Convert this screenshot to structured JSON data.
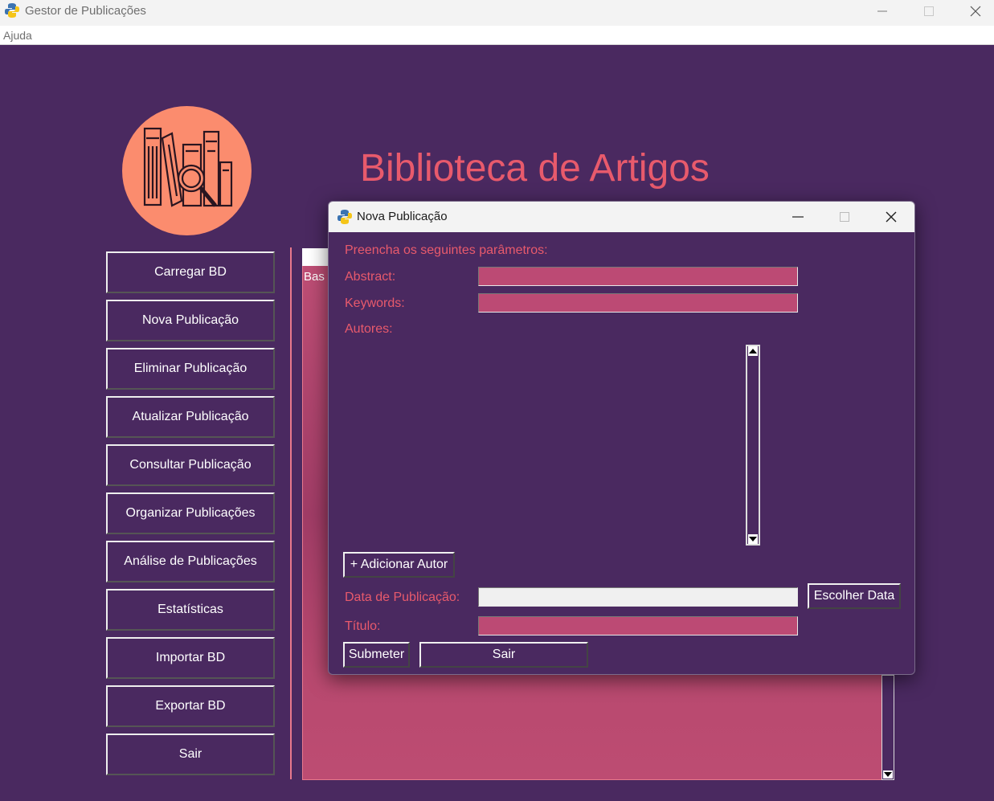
{
  "window": {
    "title": "Gestor de Publicações"
  },
  "menu": {
    "help": "Ajuda"
  },
  "header": {
    "title": "Biblioteca de Artigos"
  },
  "sidebar": {
    "buttons": [
      "Carregar BD",
      "Nova Publicação",
      "Eliminar Publicação",
      "Atualizar Publicação",
      "Consultar Publicação",
      "Organizar Publicações",
      "Análise de Publicações",
      "Estatísticas",
      "Importar BD",
      "Exportar BD",
      "Sair"
    ]
  },
  "panel": {
    "label": "Bas"
  },
  "dialog": {
    "title": "Nova Publicação",
    "instructions": "Preencha os seguintes parâmetros:",
    "abstract_label": "Abstract:",
    "keywords_label": "Keywords:",
    "authors_label": "Autores:",
    "add_author_button": "+ Adicionar Autor",
    "date_label": "Data de Publicação:",
    "choose_date_button": "Escolher Data",
    "title_label": "Título:",
    "submit_button": "Submeter",
    "exit_button": "Sair",
    "abstract_value": "",
    "keywords_value": "",
    "date_value": "",
    "title_value": ""
  },
  "colors": {
    "background": "#4a2960",
    "accent": "#e85a6c",
    "field": "#bc4a74",
    "logo": "#fb8c6e"
  }
}
